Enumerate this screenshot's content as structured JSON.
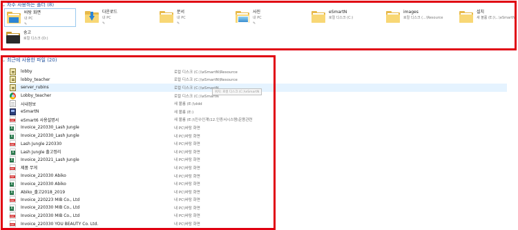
{
  "frequent": {
    "header": "자주 사용하는 폴더 (8)",
    "items": [
      {
        "name": "바탕 화면",
        "loc": "내 PC",
        "icon": "desktop-folder-icon",
        "pinned": true,
        "selected": true
      },
      {
        "name": "다운로드",
        "loc": "내 PC",
        "icon": "downloads-folder-icon",
        "pinned": true
      },
      {
        "name": "문서",
        "loc": "내 PC",
        "icon": "documents-folder-icon",
        "pinned": true
      },
      {
        "name": "사진",
        "loc": "내 PC",
        "icon": "pictures-folder-icon",
        "pinned": true
      },
      {
        "name": "eSmartN",
        "loc": "로컬 디스크 (C:)",
        "icon": "folder-icon"
      },
      {
        "name": "images",
        "loc": "로컬 디스크 (...\\Resource",
        "icon": "folder-icon"
      },
      {
        "name": "설치",
        "loc": "새 볼륨 (E:)\\...\\eSmartN",
        "icon": "folder-icon"
      },
      {
        "name": "숭고",
        "loc": "로컬 디스크 (D:)",
        "icon": "folder-icon"
      }
    ]
  },
  "recent": {
    "header": "최근에 사용한 파일 (20)",
    "files": [
      {
        "name": "lobby",
        "path": "로컬 디스크 (C:)\\eSmartN\\Resource",
        "type": "script"
      },
      {
        "name": "lobby_teacher",
        "path": "로컬 디스크 (C:)\\eSmartN\\Resource",
        "type": "script"
      },
      {
        "name": "server_rubins",
        "path": "로컬 디스크 (C:)\\eSmartN",
        "type": "script"
      },
      {
        "name": "Lobby_teacher",
        "path": "로컬 디스크 (C:)\\eSmartN",
        "type": "chrome"
      },
      {
        "name": "사내정보",
        "path": "새 볼륨 (E:)\\ddd",
        "type": "txt"
      },
      {
        "name": "eSmartN",
        "path": "새 볼륨 (E:)",
        "type": "exe"
      },
      {
        "name": "eSmart6 사용설명서",
        "path": "새 볼륨 (E:)\\민수인계\\12.인증서시스템\\운용관련",
        "type": "pdf"
      },
      {
        "name": "Invoice_220330_Lash Jungle",
        "path": "내 PC\\바탕 화면",
        "type": "xlsx"
      },
      {
        "name": "Invoice_220330_Lash Jungle",
        "path": "내 PC\\바탕 화면",
        "type": "xlsx"
      },
      {
        "name": "Lash Jungle 220330",
        "path": "내 PC\\바탕 화면",
        "type": "pdf"
      },
      {
        "name": "Lash Jungle 출고정리",
        "path": "내 PC\\바탕 화면",
        "type": "xlsx-mid"
      },
      {
        "name": "Invoice_220321_Lash Jungle",
        "path": "내 PC\\바탕 화면",
        "type": "xlsx"
      },
      {
        "name": "제품 무게",
        "path": "내 PC\\바탕 화면",
        "type": "pdf"
      },
      {
        "name": "Invoice_220330 Abiko",
        "path": "내 PC\\바탕 화면",
        "type": "pdf"
      },
      {
        "name": "Invoice_220330 Abiko",
        "path": "내 PC\\바탕 화면",
        "type": "xlsx"
      },
      {
        "name": "Abiko_출고2018_2019",
        "path": "내 PC\\바탕 화면",
        "type": "xlsx"
      },
      {
        "name": "Invoice_220223 MIB Co., Ltd",
        "path": "내 PC\\바탕 화면",
        "type": "pdf"
      },
      {
        "name": "Invoice_220330 MIB Co., Ltd",
        "path": "내 PC\\바탕 화면",
        "type": "xlsx"
      },
      {
        "name": "Invoice_220330 MIB Co., Ltd",
        "path": "내 PC\\바탕 화면",
        "type": "pdf"
      },
      {
        "name": "Invoice_220330 YOU BEAUTY Co. Ltd.",
        "path": "내 PC\\바탕 화면",
        "type": "pdf"
      }
    ],
    "tooltip": "위치: 로컬 디스크 (C:)\\eSmartN"
  },
  "colors": {
    "highlight_box": "#e00010",
    "header_text": "#1e4f9c",
    "hover_row": "#e5f3ff"
  }
}
